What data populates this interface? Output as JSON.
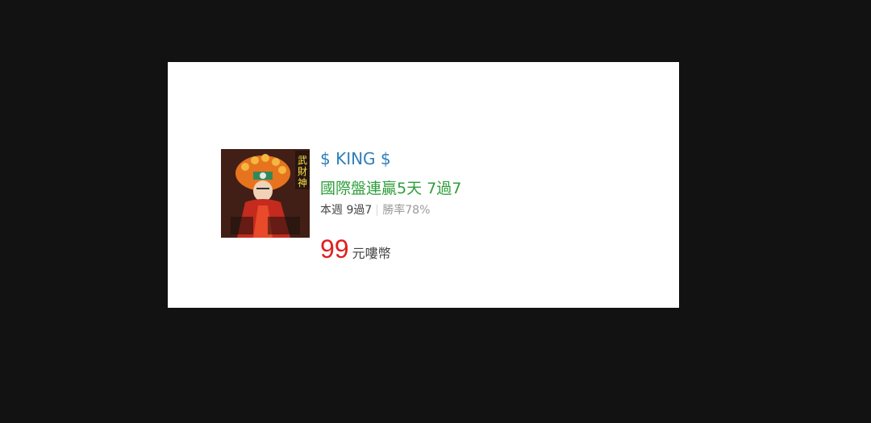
{
  "product": {
    "seller_name": "$ KING $",
    "headline": "國際盤連贏5天 7過7",
    "stats": {
      "weekly": "本週 9過7",
      "win_rate": "勝率78%"
    },
    "price": {
      "amount": "99",
      "unit": "元嘍幣"
    },
    "avatar": {
      "icon": "deity-portrait-icon",
      "caption_chars": [
        "武",
        "財",
        "神"
      ],
      "colors": {
        "background": "#2a1512",
        "crown": "#e8731e",
        "robe": "#c42a1e",
        "text": "#f2e24a"
      }
    }
  },
  "colors": {
    "page_background": "#121212",
    "card_background": "#ffffff",
    "name": "#2f7fb8",
    "headline": "#2e9e3a",
    "price": "#e02020"
  }
}
